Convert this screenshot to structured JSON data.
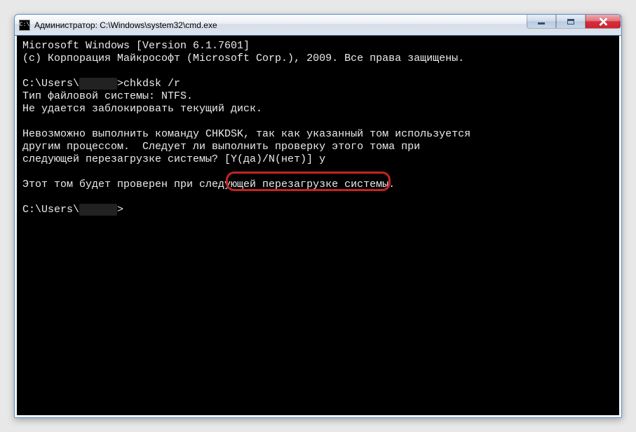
{
  "window": {
    "title": "Администратор: C:\\Windows\\system32\\cmd.exe",
    "icon_text": "C:\\"
  },
  "console": {
    "line1": "Microsoft Windows [Version 6.1.7601]",
    "line2": "(c) Корпорация Майкрософт (Microsoft Corp.), 2009. Все права защищены.",
    "blank": "",
    "prompt1_pre": "C:\\Users\\",
    "prompt1_blur": "      ",
    "prompt1_cmd": ">chkdsk /r",
    "line_fs": "Тип файловой системы: NTFS.",
    "line_lock": "Не удается заблокировать текущий диск.",
    "line_msg1": "Невозможно выполнить команду CHKDSK, так как указанный том используется",
    "line_msg2": "другим процессом.  Следует ли выполнить проверку этого тома при",
    "line_msg3_pre": "следующей перезагрузке системы? ",
    "line_msg3_choice": "[Y(да)/N(нет)] y",
    "line_confirm": "Этот том будет проверен при следующей перезагрузке системы.",
    "prompt2_pre": "C:\\Users\\",
    "prompt2_blur": "      ",
    "prompt2_cmd": ">"
  }
}
